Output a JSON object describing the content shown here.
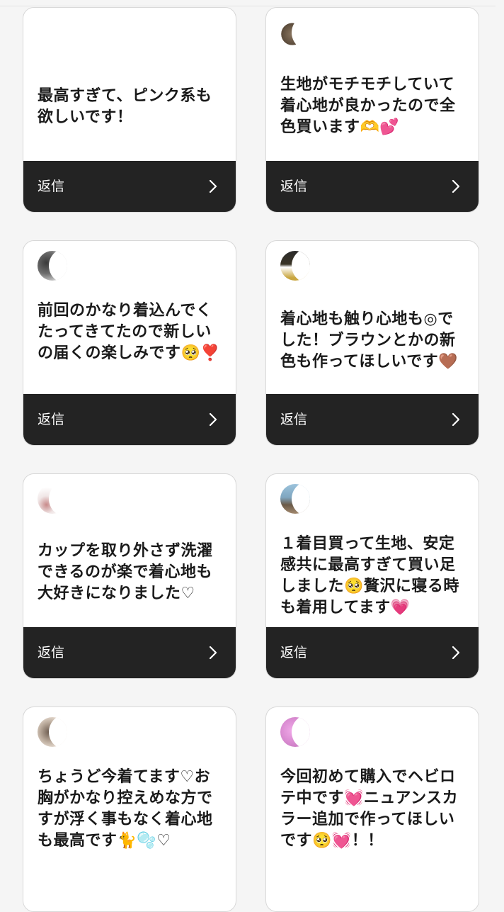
{
  "reply_label": "返信",
  "cards": [
    {
      "message": "最高すぎて、ピンク系も欲しいです！",
      "avatar_color": "#ffffff"
    },
    {
      "message": "生地がモチモチしていて着心地が良かったので全色買います🫶💕",
      "avatar_color": "#7a6a58"
    },
    {
      "message": "前回のかなり着込んでくたってきてたので新しいの届くの楽しみです🥺❣️",
      "avatar_color": "#5b5b5b"
    },
    {
      "message": "着心地も触り心地も◎でした！ブラウンとかの新色も作ってほしいです🤎",
      "avatar_color": "#3a3426"
    },
    {
      "message": "カップを取り外さず洗濯できるのが楽で着心地も大好きになりました♡",
      "avatar_color": "#d9c9c9"
    },
    {
      "message": "１着目買って生地、安定感共に最高すぎて買い足しました🥺贅沢に寝る時も着用してます💗",
      "avatar_color": "#7fa6c0"
    },
    {
      "message": "ちょうど今着てます♡お胸がかなり控えめな方ですが浮く事もなく着心地も最高です🐈🫧♡",
      "avatar_color": "#9a8a7e"
    },
    {
      "message": "今回初めて購入でヘビロテ中です💓ニュアンスカラー追加で作ってほしいです🥺💓！！",
      "avatar_color": "#d88ad0"
    }
  ]
}
